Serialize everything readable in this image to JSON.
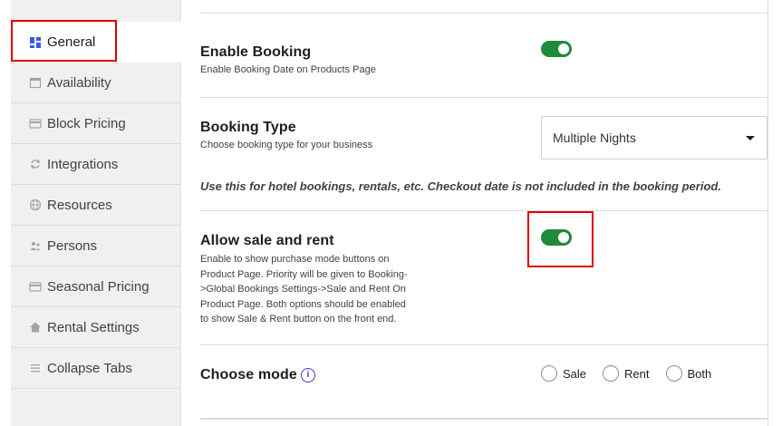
{
  "sidebar": {
    "items": [
      {
        "label": "General",
        "icon": "dashboard-icon",
        "active": true
      },
      {
        "label": "Availability",
        "icon": "calendar-icon"
      },
      {
        "label": "Block Pricing",
        "icon": "card-icon"
      },
      {
        "label": "Integrations",
        "icon": "sync-icon"
      },
      {
        "label": "Resources",
        "icon": "globe-icon"
      },
      {
        "label": "Persons",
        "icon": "groups-icon"
      },
      {
        "label": "Seasonal Pricing",
        "icon": "card-icon"
      },
      {
        "label": "Rental Settings",
        "icon": "home-icon"
      },
      {
        "label": "Collapse Tabs",
        "icon": "menu-icon"
      }
    ]
  },
  "settings": {
    "enable_booking": {
      "title": "Enable Booking",
      "desc": "Enable Booking Date on Products Page",
      "enabled": true
    },
    "booking_type": {
      "title": "Booking Type",
      "desc": "Choose booking type for your business",
      "selected": "Multiple Nights",
      "note": "Use this for hotel bookings, rentals, etc. Checkout date is not included in the booking period."
    },
    "allow_sale_rent": {
      "title": "Allow sale and rent",
      "desc_lines": [
        "Enable to show purchase mode buttons on",
        "Product Page. Priority will be given to Booking-",
        ">Global Bookings Settings->Sale and Rent On",
        "Product Page. Both options should be enabled",
        "to show Sale & Rent button on the front end."
      ],
      "enabled": true
    },
    "choose_mode": {
      "title": "Choose mode",
      "info_glyph": "i",
      "options": [
        "Sale",
        "Rent",
        "Both"
      ]
    }
  },
  "colors": {
    "toggle_on": "#1f8a3a",
    "highlight": "#e00000",
    "info": "#3b3bd0"
  }
}
